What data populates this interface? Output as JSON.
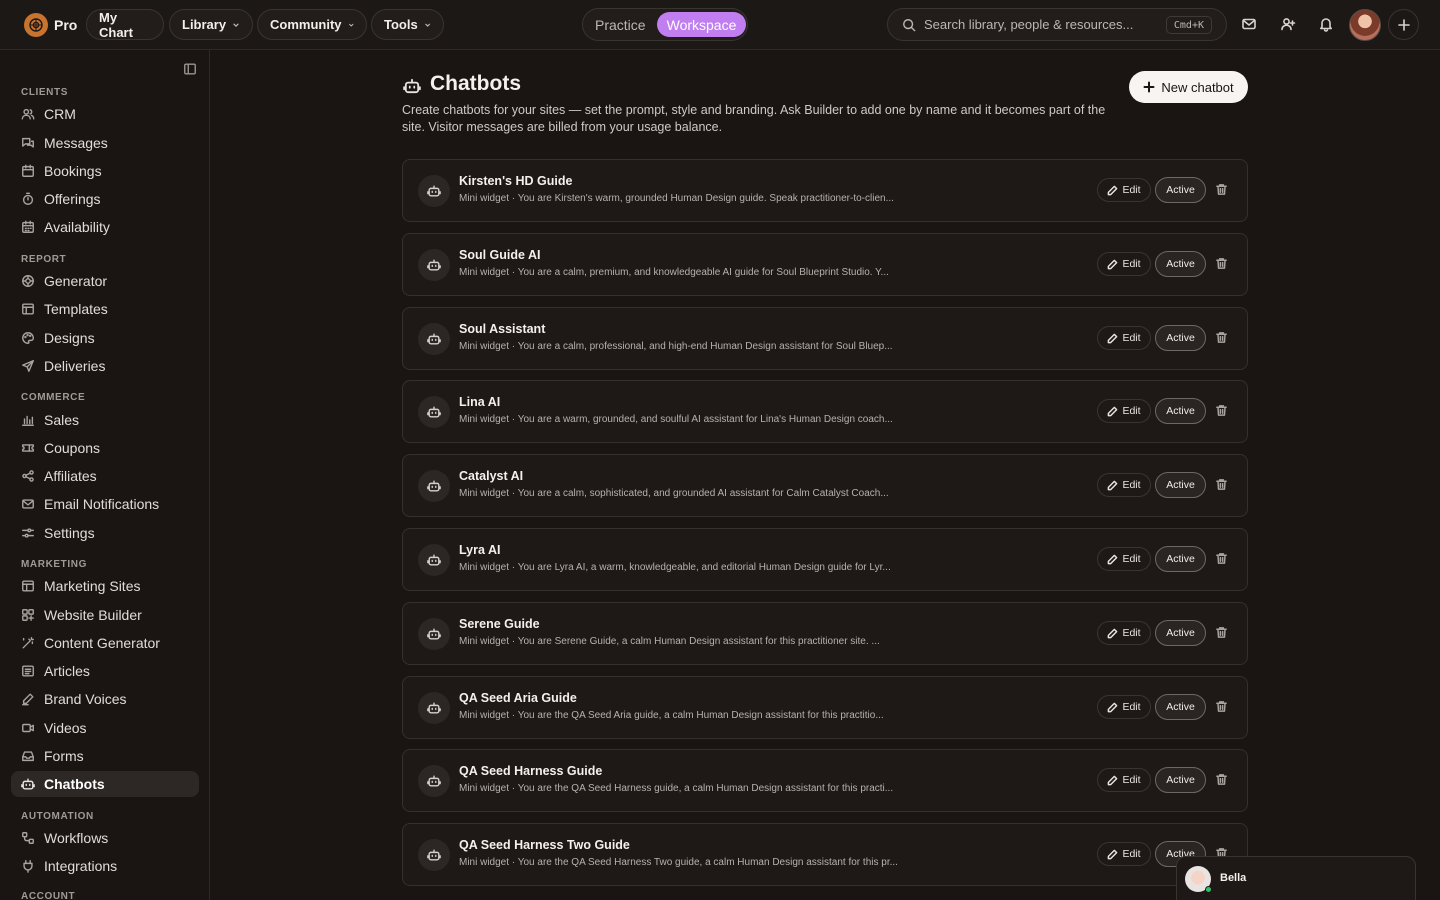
{
  "topbar": {
    "brand": "Pro",
    "nav": [
      {
        "label": "My Chart",
        "dropdown": false
      },
      {
        "label": "Library",
        "dropdown": true
      },
      {
        "label": "Community",
        "dropdown": true
      },
      {
        "label": "Tools",
        "dropdown": true
      }
    ],
    "mode": {
      "practice": "Practice",
      "workspace": "Workspace",
      "active": "workspace"
    },
    "search": {
      "placeholder": "Search library, people & resources...",
      "shortcut": "Cmd+K"
    },
    "icons": [
      "mail-icon",
      "add-person-icon",
      "bell-icon"
    ]
  },
  "sidebar": {
    "sections": [
      {
        "title": "CLIENTS",
        "items": [
          {
            "label": "CRM",
            "icon": "users-icon"
          },
          {
            "label": "Messages",
            "icon": "messages-icon"
          },
          {
            "label": "Bookings",
            "icon": "calendar-icon"
          },
          {
            "label": "Offerings",
            "icon": "timer-icon"
          },
          {
            "label": "Availability",
            "icon": "calendar-grid-icon"
          }
        ]
      },
      {
        "title": "REPORT",
        "items": [
          {
            "label": "Generator",
            "icon": "generator-icon"
          },
          {
            "label": "Templates",
            "icon": "templates-icon"
          },
          {
            "label": "Designs",
            "icon": "palette-icon"
          },
          {
            "label": "Deliveries",
            "icon": "send-icon"
          }
        ]
      },
      {
        "title": "COMMERCE",
        "items": [
          {
            "label": "Sales",
            "icon": "bar-chart-icon"
          },
          {
            "label": "Coupons",
            "icon": "ticket-icon"
          },
          {
            "label": "Affiliates",
            "icon": "share-icon"
          },
          {
            "label": "Email Notifications",
            "icon": "mail-icon"
          },
          {
            "label": "Settings",
            "icon": "sliders-icon"
          }
        ]
      },
      {
        "title": "MARKETING",
        "items": [
          {
            "label": "Marketing Sites",
            "icon": "layout-icon"
          },
          {
            "label": "Website Builder",
            "icon": "blocks-icon"
          },
          {
            "label": "Content Generator",
            "icon": "wand-icon"
          },
          {
            "label": "Articles",
            "icon": "articles-icon"
          },
          {
            "label": "Brand Voices",
            "icon": "pen-icon"
          },
          {
            "label": "Videos",
            "icon": "video-icon"
          },
          {
            "label": "Forms",
            "icon": "inbox-icon"
          },
          {
            "label": "Chatbots",
            "icon": "bot-icon",
            "active": true
          }
        ]
      },
      {
        "title": "AUTOMATION",
        "items": [
          {
            "label": "Workflows",
            "icon": "workflow-icon"
          },
          {
            "label": "Integrations",
            "icon": "plug-icon"
          }
        ]
      },
      {
        "title": "ACCOUNT",
        "items": []
      }
    ]
  },
  "main": {
    "title": "Chatbots",
    "description": "Create chatbots for your sites — set the prompt, style and branding. Ask Builder to add one by name and it becomes part of the site. Visitor messages are billed from your usage balance.",
    "new_button": "New chatbot",
    "edit_label": "Edit",
    "status_label": "Active",
    "chatbots": [
      {
        "name": "Kirsten's HD Guide",
        "subtitle": "Mini widget · You are Kirsten's warm, grounded Human Design guide. Speak practitioner-to-clien..."
      },
      {
        "name": "Soul Guide AI",
        "subtitle": "Mini widget · You are a calm, premium, and knowledgeable AI guide for Soul Blueprint Studio. Y..."
      },
      {
        "name": "Soul Assistant",
        "subtitle": "Mini widget · You are a calm, professional, and high-end Human Design assistant for Soul Bluep..."
      },
      {
        "name": "Lina AI",
        "subtitle": "Mini widget · You are a warm, grounded, and soulful AI assistant for Lina's Human Design coach..."
      },
      {
        "name": "Catalyst AI",
        "subtitle": "Mini widget · You are a calm, sophisticated, and grounded AI assistant for Calm Catalyst Coach..."
      },
      {
        "name": "Lyra AI",
        "subtitle": "Mini widget · You are Lyra AI, a warm, knowledgeable, and editorial Human Design guide for Lyr..."
      },
      {
        "name": "Serene Guide",
        "subtitle": "Mini widget · You are Serene Guide, a calm Human Design assistant for this practitioner site. ..."
      },
      {
        "name": "QA Seed Aria Guide",
        "subtitle": "Mini widget · You are the QA Seed Aria guide, a calm Human Design assistant for this practitio..."
      },
      {
        "name": "QA Seed Harness Guide",
        "subtitle": "Mini widget · You are the QA Seed Harness guide, a calm Human Design assistant for this practi..."
      },
      {
        "name": "QA Seed Harness Two Guide",
        "subtitle": "Mini widget · You are the QA Seed Harness Two guide, a calm Human Design assistant for this pr..."
      }
    ]
  },
  "chat_widget": {
    "name": "Bella",
    "online": true
  },
  "colors": {
    "background": "#1a1513",
    "accent": "#c07ef0",
    "brand": "#c8732e",
    "online": "#31c06a"
  }
}
